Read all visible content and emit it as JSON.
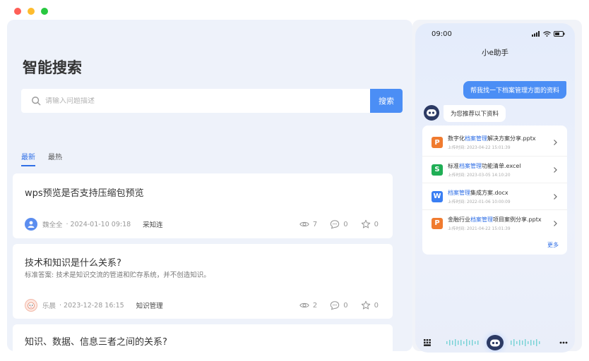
{
  "window": {
    "controls": [
      {
        "name": "close",
        "color": "#fe5f57"
      },
      {
        "name": "minimize",
        "color": "#febc2e"
      },
      {
        "name": "maximize",
        "color": "#28c840"
      }
    ]
  },
  "main": {
    "title": "智能搜索",
    "search": {
      "placeholder": "请输入问题描述",
      "button_label": "搜索"
    },
    "tabs": [
      {
        "label": "最新",
        "active": true
      },
      {
        "label": "最热",
        "active": false
      }
    ],
    "cards": [
      {
        "title": "wps预览是否支持压缩包预览",
        "subtitle": "",
        "author": "魏全全",
        "datetime": "· 2024-01-10 09:18",
        "tag": "采知连",
        "views": "7",
        "comments": "0",
        "favorites": "0"
      },
      {
        "title": "技术和知识是什么关系?",
        "subtitle": "标准答案:  技术是知识交流的管道和贮存系统，并不创造知识。",
        "author": "乐晨",
        "datetime": "· 2023-12-28 16:15",
        "tag": "知识管理",
        "views": "2",
        "comments": "0",
        "favorites": "0"
      },
      {
        "title": "知识、数据、信息三者之间的关系?",
        "subtitle": "",
        "author": "",
        "datetime": "",
        "tag": "",
        "views": "",
        "comments": "",
        "favorites": ""
      }
    ]
  },
  "assistant": {
    "status_time": "09:00",
    "title": "小e助手",
    "user_message": "帮我找一下档案管理方面的资料",
    "bot_message": "为您推荐以下资料",
    "files": [
      {
        "type": "ppt",
        "glyph": "P",
        "color": "#f07b2f",
        "name_before": "数字化",
        "highlight": "档案管理",
        "name_after": "解决方案分享.pptx",
        "time": "上传时间: 2023-04-22 15:01:39"
      },
      {
        "type": "excel",
        "glyph": "S",
        "color": "#1fae55",
        "name_before": "标准",
        "highlight": "档案管理",
        "name_after": "功能清单.excel",
        "time": "上传时间: 2023-03-05 14:10:20"
      },
      {
        "type": "word",
        "glyph": "W",
        "color": "#3a7ef3",
        "name_before": "",
        "highlight": "档案管理",
        "name_after": "集成方案.docx",
        "time": "上传时间: 2022-01-06 10:00:09"
      },
      {
        "type": "ppt",
        "glyph": "P",
        "color": "#f07b2f",
        "name_before": "金融行业",
        "highlight": "档案管理",
        "name_after": "项目案例分享.pptx",
        "time": "上传时间: 2021-04-22 15:01:39"
      }
    ],
    "more_label": "更多"
  }
}
